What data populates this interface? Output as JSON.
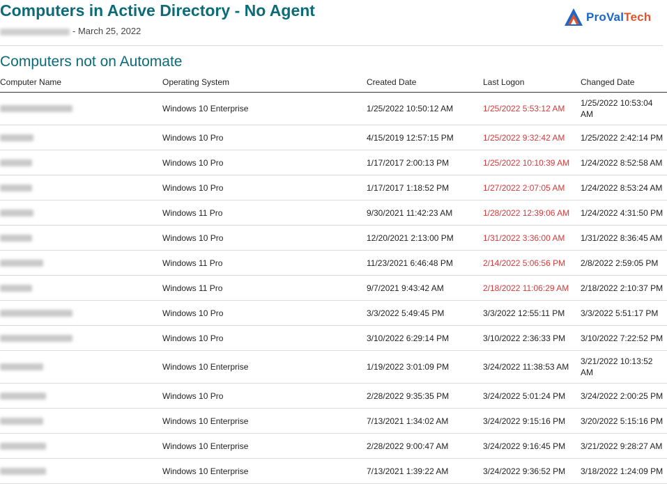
{
  "report": {
    "title": "Computers in Active Directory - No Agent",
    "subtitle_date": "- March 25, 2022"
  },
  "logo": {
    "part1": "ProVal",
    "part2": "Tech"
  },
  "section": {
    "title": "Computers not on Automate"
  },
  "table": {
    "headers": [
      "Computer Name",
      "Operating System",
      "Created Date",
      "Last Logon",
      "Changed Date"
    ],
    "highlight_color": "#d23a3a",
    "rows": [
      {
        "name_redacted": true,
        "os": "Windows 10 Enterprise",
        "created": "1/25/2022 10:50:12 AM",
        "last_logon": "1/25/2022 5:53:12 AM",
        "logon_highlight": true,
        "changed": "1/25/2022 10:53:04 AM"
      },
      {
        "name_redacted": true,
        "os": "Windows 10 Pro",
        "created": "4/15/2019 12:57:15 PM",
        "last_logon": "1/25/2022 9:32:42 AM",
        "logon_highlight": true,
        "changed": "1/25/2022 2:42:14 PM"
      },
      {
        "name_redacted": true,
        "os": "Windows 10 Pro",
        "created": "1/17/2017 2:00:13 PM",
        "last_logon": "1/25/2022 10:10:39 AM",
        "logon_highlight": true,
        "changed": "1/24/2022 8:52:58 AM"
      },
      {
        "name_redacted": true,
        "os": "Windows 10 Pro",
        "created": "1/17/2017 1:18:52 PM",
        "last_logon": "1/27/2022 2:07:05 AM",
        "logon_highlight": true,
        "changed": "1/24/2022 8:53:24 AM"
      },
      {
        "name_redacted": true,
        "os": "Windows 11 Pro",
        "created": "9/30/2021 11:42:23 AM",
        "last_logon": "1/28/2022 12:39:06 AM",
        "logon_highlight": true,
        "changed": "1/24/2022 4:31:50 PM"
      },
      {
        "name_redacted": true,
        "os": "Windows 10 Pro",
        "created": "12/20/2021 2:13:00 PM",
        "last_logon": "1/31/2022 3:36:00 AM",
        "logon_highlight": true,
        "changed": "1/31/2022 8:36:45 AM"
      },
      {
        "name_redacted": true,
        "os": "Windows 11 Pro",
        "created": "11/23/2021 6:46:48 PM",
        "last_logon": "2/14/2022 5:06:56 PM",
        "logon_highlight": true,
        "changed": "2/8/2022 2:59:05 PM"
      },
      {
        "name_redacted": true,
        "os": "Windows 11 Pro",
        "created": "9/7/2021 9:43:42 AM",
        "last_logon": "2/18/2022 11:06:29 AM",
        "logon_highlight": true,
        "changed": "2/18/2022 2:10:37 PM"
      },
      {
        "name_redacted": true,
        "os": "Windows 10 Pro",
        "created": "3/3/2022 5:49:45 PM",
        "last_logon": "3/3/2022 12:55:11 PM",
        "logon_highlight": false,
        "changed": "3/3/2022 5:51:17 PM"
      },
      {
        "name_redacted": true,
        "os": "Windows 10 Pro",
        "created": "3/10/2022 6:29:14 PM",
        "last_logon": "3/10/2022 2:36:33 PM",
        "logon_highlight": false,
        "changed": "3/10/2022 7:22:52 PM"
      },
      {
        "name_redacted": true,
        "os": "Windows 10 Enterprise",
        "created": "1/19/2022 3:01:09 PM",
        "last_logon": "3/24/2022 11:38:53 AM",
        "logon_highlight": false,
        "changed": "3/21/2022 10:13:52 AM"
      },
      {
        "name_redacted": true,
        "os": "Windows 10 Pro",
        "created": "2/28/2022 9:35:35 PM",
        "last_logon": "3/24/2022 5:01:24 PM",
        "logon_highlight": false,
        "changed": "3/24/2022 2:00:25 PM"
      },
      {
        "name_redacted": true,
        "os": "Windows 10 Enterprise",
        "created": "7/13/2021 1:34:02 AM",
        "last_logon": "3/24/2022 9:15:16 PM",
        "logon_highlight": false,
        "changed": "3/20/2022 5:15:16 PM"
      },
      {
        "name_redacted": true,
        "os": "Windows 10 Enterprise",
        "created": "2/28/2022 9:00:47 AM",
        "last_logon": "3/24/2022 9:16:45 PM",
        "logon_highlight": false,
        "changed": "3/21/2022 9:28:27 AM"
      },
      {
        "name_redacted": true,
        "os": "Windows 10 Enterprise",
        "created": "7/13/2021 1:39:22 AM",
        "last_logon": "3/24/2022 9:36:52 PM",
        "logon_highlight": false,
        "changed": "3/18/2022 1:24:09 PM"
      }
    ]
  }
}
